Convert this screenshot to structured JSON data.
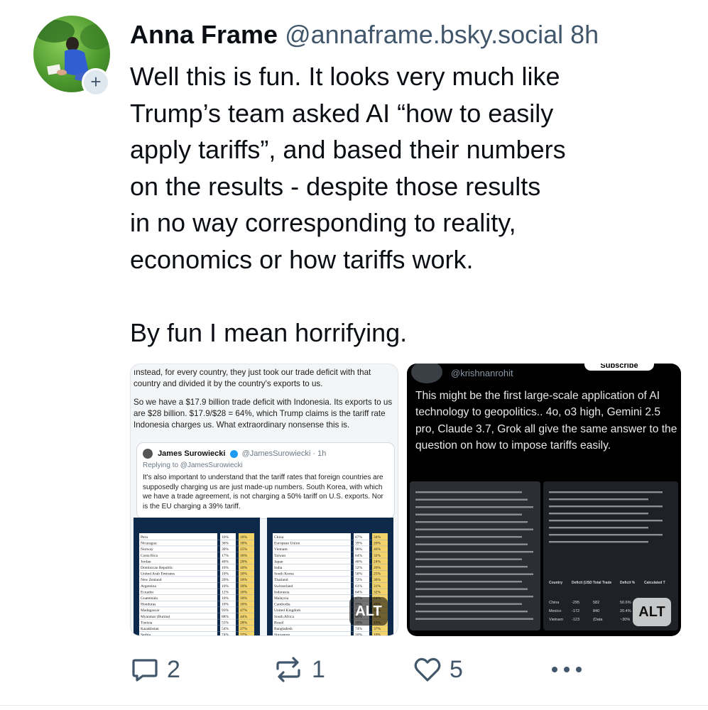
{
  "post": {
    "author": {
      "display_name": "Anna Frame",
      "handle": "@annaframe.bsky.social",
      "follow_label": "+"
    },
    "timestamp": "8h",
    "text_lines": [
      "Well this is fun. It looks very much like",
      "Trump’s team asked AI “how to easily",
      "apply tariffs”, and based their numbers",
      "on the results - despite those results",
      "in no way corresponding to reality,",
      "economics or how tariffs work."
    ],
    "text_line_2": "By fun I mean horrifying."
  },
  "media": {
    "left": {
      "alt_label": "ALT",
      "intro_1": "ınstead, for every country, they just took our trade deficit with that country and divided it by the country's exports to us.",
      "intro_2": "So we have a $17.9 billion trade deficit with Indonesia. Its exports to us are $28 billion. $17.9/$28 = 64%, which Trump claims is the tariff rate Indonesia charges us. What extraordinary nonsense this is.",
      "quote": {
        "name": "James Surowiecki",
        "handle": "@JamesSurowiecki · 1h",
        "reply": "Replying to @JamesSurowiecki",
        "body": "It's also important to understand that the tariff rates that foreign countries are supposedly charging us are just made-up numbers. South Korea, with which we have a trade agreement, is not charging a 50% tariff on U.S. exports. Nor is the EU charging a 39% tariff."
      },
      "table_left": [
        [
          "Peru",
          "10%",
          "10%"
        ],
        [
          "Nicaragua",
          "36%",
          "18%"
        ],
        [
          "Norway",
          "30%",
          "15%"
        ],
        [
          "Costa Rica",
          "17%",
          "10%"
        ],
        [
          "Jordan",
          "40%",
          "20%"
        ],
        [
          "Dominican Republic",
          "10%",
          "10%"
        ],
        [
          "United Arab Emirates",
          "10%",
          "10%"
        ],
        [
          "New Zealand",
          "20%",
          "10%"
        ],
        [
          "Argentina",
          "10%",
          "10%"
        ],
        [
          "Ecuador",
          "12%",
          "10%"
        ],
        [
          "Guatemala",
          "10%",
          "10%"
        ],
        [
          "Honduras",
          "10%",
          "10%"
        ],
        [
          "Madagascar",
          "93%",
          "47%"
        ],
        [
          "Myanmar (Burma)",
          "88%",
          "44%"
        ],
        [
          "Tunisia",
          "55%",
          "28%"
        ],
        [
          "Kazakhstan",
          "54%",
          "27%"
        ],
        [
          "Serbia",
          "74%",
          "37%"
        ]
      ],
      "table_right": [
        [
          "China",
          "67%",
          "34%"
        ],
        [
          "European Union",
          "39%",
          "20%"
        ],
        [
          "Vietnam",
          "90%",
          "46%"
        ],
        [
          "Taiwan",
          "64%",
          "32%"
        ],
        [
          "Japan",
          "46%",
          "24%"
        ],
        [
          "India",
          "52%",
          "26%"
        ],
        [
          "South Korea",
          "50%",
          "25%"
        ],
        [
          "Thailand",
          "72%",
          "36%"
        ],
        [
          "Switzerland",
          "61%",
          "31%"
        ],
        [
          "Indonesia",
          "64%",
          "32%"
        ],
        [
          "Malaysia",
          "47%",
          "24%"
        ],
        [
          "Cambodia",
          "97%",
          "49%"
        ],
        [
          "United Kingdom",
          "10%",
          "10%"
        ],
        [
          "South Africa",
          "60%",
          "30%"
        ],
        [
          "Brazil",
          "10%",
          "10%"
        ],
        [
          "Bangladesh",
          "74%",
          "37%"
        ],
        [
          "Singapore",
          "10%",
          "10%"
        ]
      ]
    },
    "right": {
      "alt_label": "ALT",
      "handle": "@krishnanrohit",
      "subscribe_label": "Subscribe",
      "body": "This might be the first large-scale application of AI technology to geopolitics.. 4o, o3 high, Gemini 2.5 pro, Claude 3.7, Grok all give the same answer to the question on how to impose tariffs easily.",
      "table_header": [
        "Country",
        "Deficit (USD Billion)",
        "Total Trade (USD Billion)",
        "Deficit %",
        "Calculated Tariff %"
      ],
      "table_rows": [
        [
          "China",
          "-295",
          "582",
          "50.6%"
        ],
        [
          "Mexico",
          "-172",
          "840",
          "20.4%"
        ],
        [
          "Vietnam",
          "-123",
          "(Data",
          "~30%"
        ]
      ]
    }
  },
  "actions": {
    "replies": "2",
    "reposts": "1",
    "likes": "5"
  },
  "colors": {
    "text": "#0b0f14",
    "muted": "#42576c",
    "divider": "#e2e7ec"
  }
}
